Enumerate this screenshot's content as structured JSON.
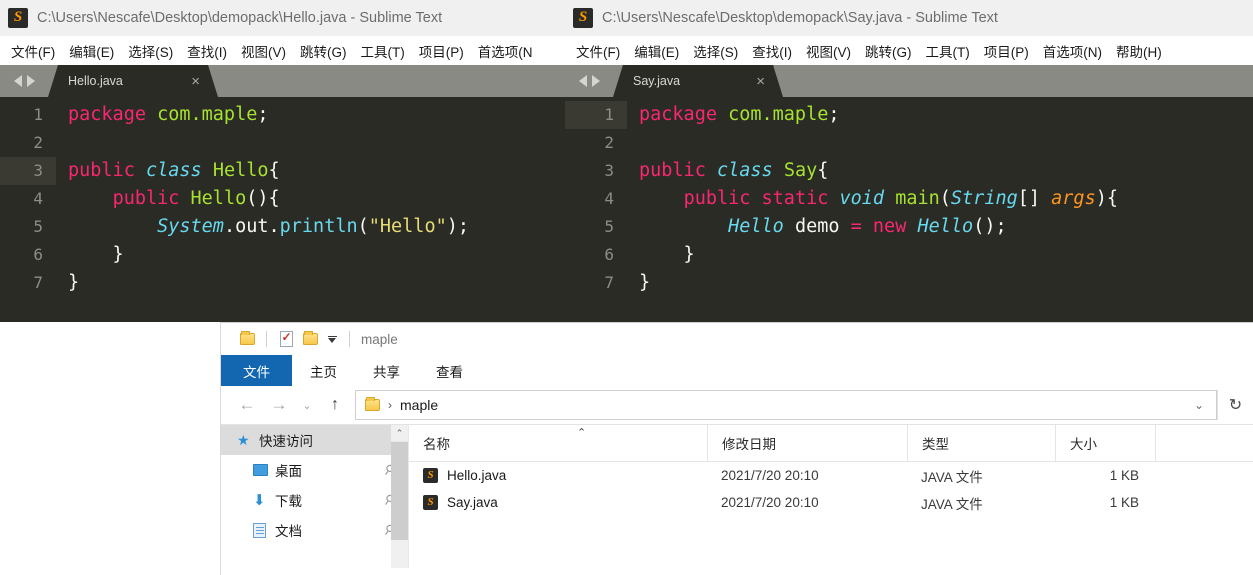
{
  "windows": {
    "sublime_left": {
      "titlebar": {
        "icon": "sublime-text-icon",
        "title": "C:\\Users\\Nescafe\\Desktop\\demopack\\Hello.java - Sublime Text"
      },
      "menu": [
        "文件(F)",
        "编辑(E)",
        "选择(S)",
        "查找(I)",
        "视图(V)",
        "跳转(G)",
        "工具(T)",
        "项目(P)",
        "首选项(N"
      ],
      "tab": {
        "label": "Hello.java",
        "close": "×"
      },
      "active_line": 3,
      "lines": [
        {
          "n": "1",
          "tokens": [
            {
              "t": "package",
              "c": "k-kw"
            },
            {
              "t": " ",
              "c": "k-plain"
            },
            {
              "t": "com.maple",
              "c": "k-ns"
            },
            {
              "t": ";",
              "c": "k-plain"
            }
          ]
        },
        {
          "n": "2",
          "tokens": []
        },
        {
          "n": "3",
          "tokens": [
            {
              "t": "public",
              "c": "k-kw"
            },
            {
              "t": " ",
              "c": "k-plain"
            },
            {
              "t": "class",
              "c": "k-storage"
            },
            {
              "t": " ",
              "c": "k-plain"
            },
            {
              "t": "Hello",
              "c": "k-cls"
            },
            {
              "t": "{",
              "c": "k-plain"
            }
          ]
        },
        {
          "n": "4",
          "tokens": [
            {
              "t": "    ",
              "c": "k-plain"
            },
            {
              "t": "public",
              "c": "k-kw"
            },
            {
              "t": " ",
              "c": "k-plain"
            },
            {
              "t": "Hello",
              "c": "k-cls"
            },
            {
              "t": "(){",
              "c": "k-plain"
            }
          ]
        },
        {
          "n": "5",
          "tokens": [
            {
              "t": "        ",
              "c": "k-plain"
            },
            {
              "t": "System",
              "c": "k-type"
            },
            {
              "t": ".out.",
              "c": "k-plain"
            },
            {
              "t": "println",
              "c": "k-fn"
            },
            {
              "t": "(",
              "c": "k-plain"
            },
            {
              "t": "\"Hello\"",
              "c": "k-str"
            },
            {
              "t": ");",
              "c": "k-plain"
            }
          ]
        },
        {
          "n": "6",
          "tokens": [
            {
              "t": "    }",
              "c": "k-plain"
            }
          ]
        },
        {
          "n": "7",
          "tokens": [
            {
              "t": "}",
              "c": "k-plain"
            }
          ]
        }
      ]
    },
    "sublime_right": {
      "titlebar": {
        "icon": "sublime-text-icon",
        "title": "C:\\Users\\Nescafe\\Desktop\\demopack\\Say.java - Sublime Text"
      },
      "menu": [
        "文件(F)",
        "编辑(E)",
        "选择(S)",
        "查找(I)",
        "视图(V)",
        "跳转(G)",
        "工具(T)",
        "项目(P)",
        "首选项(N)",
        "帮助(H)"
      ],
      "tab": {
        "label": "Say.java",
        "close": "×"
      },
      "active_line": 1,
      "lines": [
        {
          "n": "1",
          "tokens": [
            {
              "t": "package",
              "c": "k-kw"
            },
            {
              "t": " ",
              "c": "k-plain"
            },
            {
              "t": "com.maple",
              "c": "k-ns"
            },
            {
              "t": ";",
              "c": "k-plain"
            }
          ]
        },
        {
          "n": "2",
          "tokens": []
        },
        {
          "n": "3",
          "tokens": [
            {
              "t": "public",
              "c": "k-kw"
            },
            {
              "t": " ",
              "c": "k-plain"
            },
            {
              "t": "class",
              "c": "k-storage"
            },
            {
              "t": " ",
              "c": "k-plain"
            },
            {
              "t": "Say",
              "c": "k-cls"
            },
            {
              "t": "{",
              "c": "k-plain"
            }
          ]
        },
        {
          "n": "4",
          "tokens": [
            {
              "t": "    ",
              "c": "k-plain"
            },
            {
              "t": "public static",
              "c": "k-kw"
            },
            {
              "t": " ",
              "c": "k-plain"
            },
            {
              "t": "void",
              "c": "k-storage"
            },
            {
              "t": " ",
              "c": "k-plain"
            },
            {
              "t": "main",
              "c": "k-cls"
            },
            {
              "t": "(",
              "c": "k-plain"
            },
            {
              "t": "String",
              "c": "k-type"
            },
            {
              "t": "[] ",
              "c": "k-plain"
            },
            {
              "t": "args",
              "c": "k-param"
            },
            {
              "t": "){",
              "c": "k-plain"
            }
          ]
        },
        {
          "n": "5",
          "tokens": [
            {
              "t": "        ",
              "c": "k-plain"
            },
            {
              "t": "Hello",
              "c": "k-type"
            },
            {
              "t": " demo ",
              "c": "k-plain"
            },
            {
              "t": "=",
              "c": "k-kw"
            },
            {
              "t": " ",
              "c": "k-plain"
            },
            {
              "t": "new",
              "c": "k-kw"
            },
            {
              "t": " ",
              "c": "k-plain"
            },
            {
              "t": "Hello",
              "c": "k-type"
            },
            {
              "t": "();",
              "c": "k-plain"
            }
          ]
        },
        {
          "n": "6",
          "tokens": [
            {
              "t": "    }",
              "c": "k-plain"
            }
          ]
        },
        {
          "n": "7",
          "tokens": [
            {
              "t": "}",
              "c": "k-plain"
            }
          ]
        }
      ]
    },
    "explorer": {
      "quick_access_toolbar": {
        "folder_icon": "folder-icon",
        "properties_icon": "properties-icon",
        "new_folder_icon": "new-folder-icon",
        "customize_icon": "chevron-down-icon",
        "path_label": "maple"
      },
      "ribbon_tabs": [
        "文件",
        "主页",
        "共享",
        "查看"
      ],
      "address": {
        "back_icon": "back-arrow-icon",
        "forward_icon": "forward-arrow-icon",
        "recent_icon": "chevron-down-icon",
        "up_icon": "up-arrow-icon",
        "folder_icon": "folder-icon",
        "crumb": "maple",
        "separator": "›",
        "dropdown_icon": "chevron-down-icon",
        "refresh_icon": "refresh-icon"
      },
      "nav_pane": {
        "items": [
          {
            "label": "快速访问",
            "icon": "star-icon",
            "pinned": false,
            "selected": true
          },
          {
            "label": "桌面",
            "icon": "desktop-icon",
            "pinned": true,
            "selected": false
          },
          {
            "label": "下载",
            "icon": "download-icon",
            "pinned": true,
            "selected": false
          },
          {
            "label": "文档",
            "icon": "documents-icon",
            "pinned": true,
            "selected": false
          }
        ],
        "scroll_up_icon": "chevron-up-icon"
      },
      "columns": [
        "名称",
        "修改日期",
        "类型",
        "大小"
      ],
      "sort_indicator": "⌃",
      "rows": [
        {
          "name": "Hello.java",
          "icon": "java-file-icon",
          "date": "2021/7/20 20:10",
          "type": "JAVA 文件",
          "size": "1 KB"
        },
        {
          "name": "Say.java",
          "icon": "java-file-icon",
          "date": "2021/7/20 20:10",
          "type": "JAVA 文件",
          "size": "1 KB"
        }
      ]
    }
  },
  "colors": {
    "editor_bg": "#2b2b26",
    "tabstrip_bg": "#8a8a84",
    "ribbon_file_blue": "#1267b0",
    "nav_selected": "#dcdcdc",
    "sublime_orange": "#ff9800"
  }
}
